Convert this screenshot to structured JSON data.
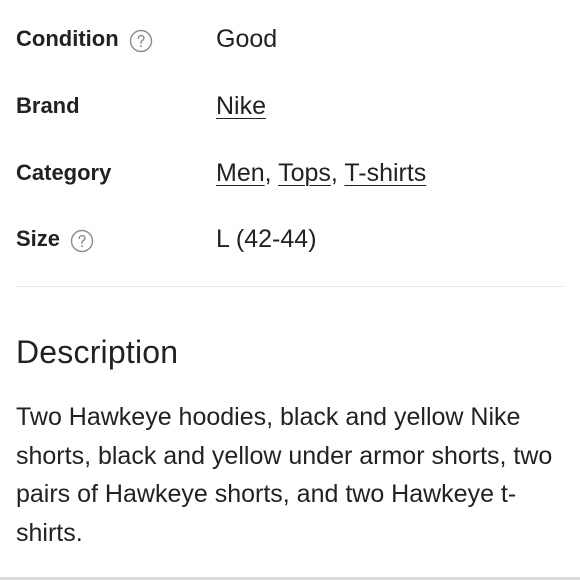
{
  "details": {
    "condition": {
      "label": "Condition",
      "value": "Good",
      "help_icon": "question-circle-icon"
    },
    "brand": {
      "label": "Brand",
      "value": "Nike"
    },
    "category": {
      "label": "Category",
      "values": [
        "Men",
        "Tops",
        "T-shirts"
      ],
      "separator": ","
    },
    "size": {
      "label": "Size",
      "value": "L (42-44)",
      "help_icon": "question-circle-icon"
    }
  },
  "description": {
    "heading": "Description",
    "text": "Two Hawkeye hoodies, black and yellow Nike shorts, black and yellow under armor shorts, two pairs of Hawkeye shorts, and two Hawkeye t-shirts."
  },
  "colors": {
    "text": "#222222",
    "divider": "#e6e6e6",
    "icon": "#8a8a8a"
  }
}
